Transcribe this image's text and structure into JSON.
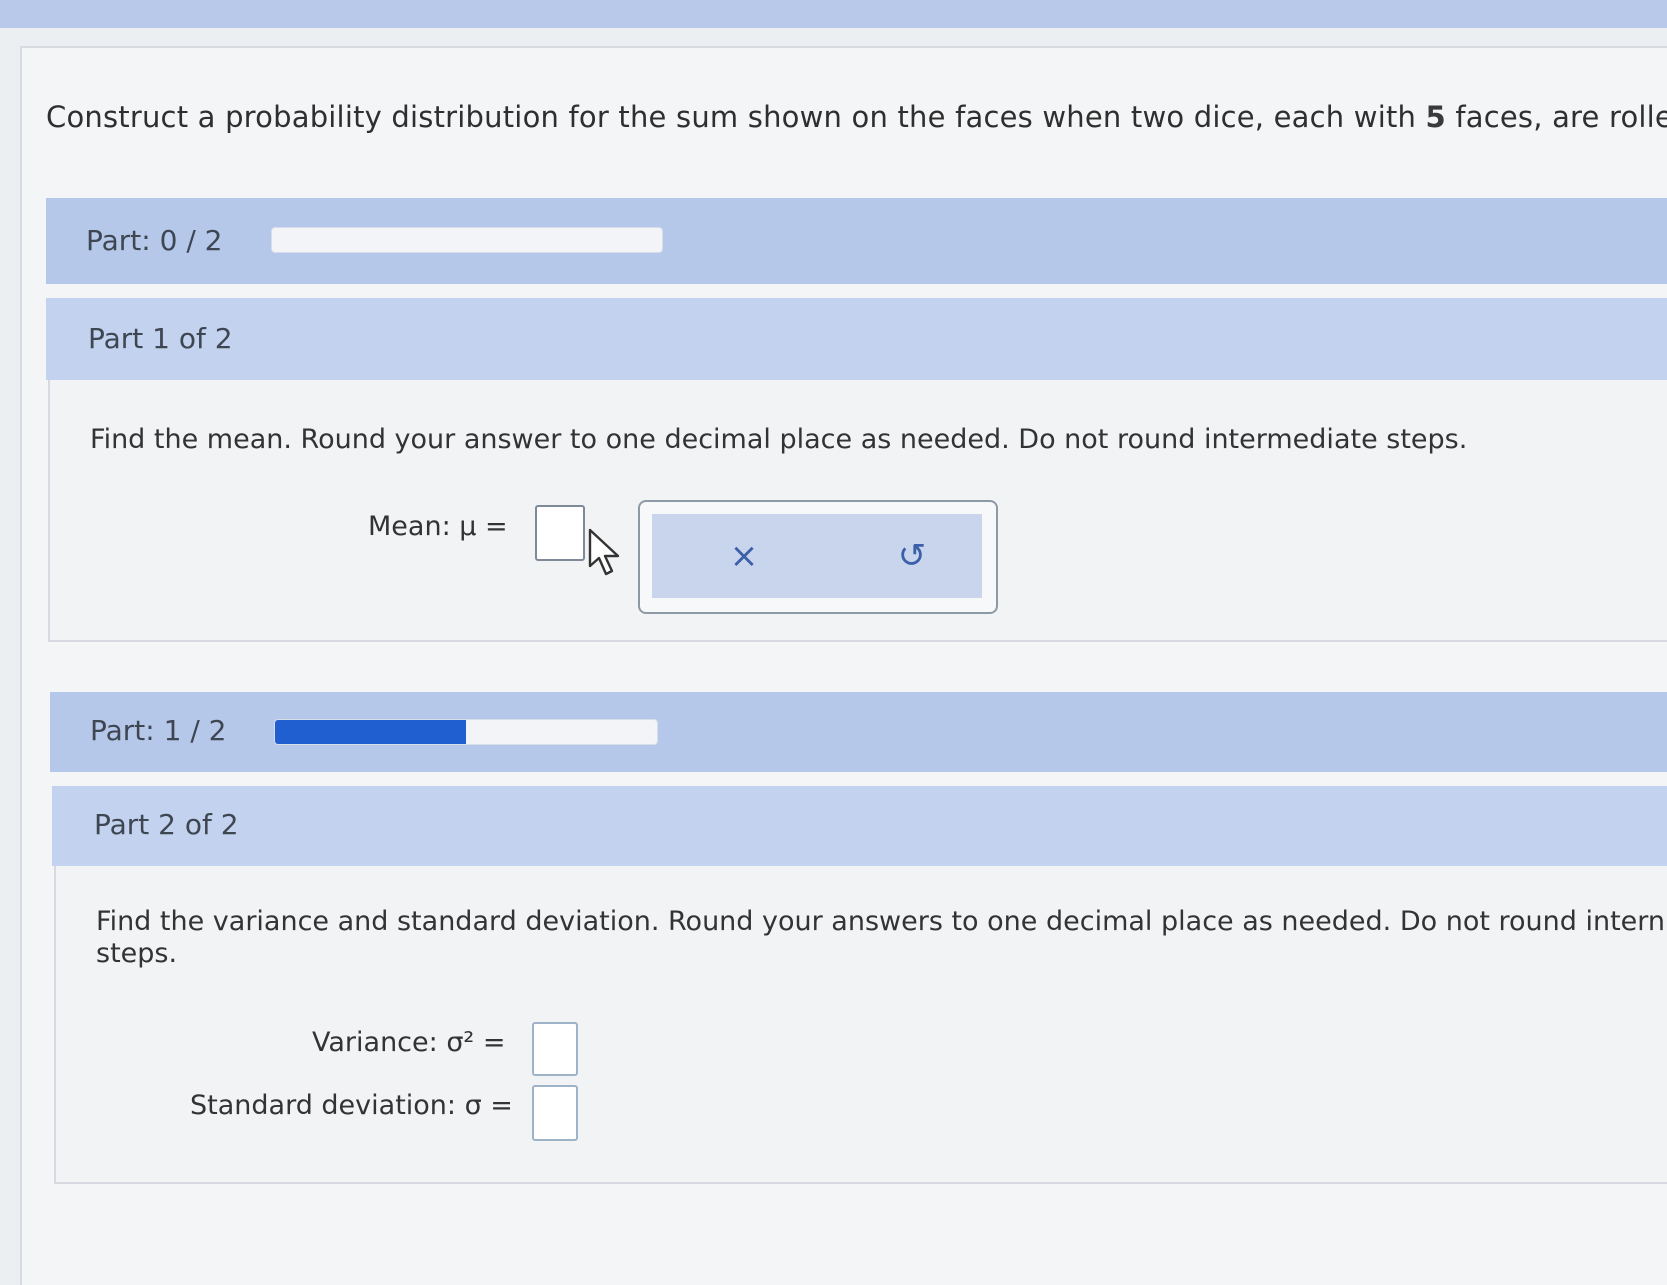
{
  "problem": {
    "text_before": "Construct a probability distribution for the sum shown on the faces when two dice, each with ",
    "faces": "5",
    "text_after": " faces, are rolled."
  },
  "progress_part1": {
    "label": "Part: 0 / 2",
    "fraction": 0.0
  },
  "part1": {
    "header": "Part 1 of 2",
    "prompt": "Find the mean. Round your answer to one decimal place as needed. Do not round intermediate steps.",
    "mean_label": "Mean: μ =",
    "mean_value": ""
  },
  "tools": {
    "clear_icon": "close-icon",
    "clear_glyph": "×",
    "undo_icon": "undo-icon",
    "undo_glyph": "↺"
  },
  "progress_part2": {
    "label": "Part: 1 / 2",
    "fraction": 0.5
  },
  "part2": {
    "header": "Part 2 of 2",
    "prompt_line1": "Find the variance and standard deviation. Round your answers to one decimal place as needed. Do not round intern",
    "prompt_line2": "steps.",
    "variance_label": "Variance: σ² =",
    "variance_value": "",
    "sd_label": "Standard deviation: σ =",
    "sd_value": ""
  },
  "colors": {
    "progress_fill": "#1f5fd0",
    "header_blue": "#b6c8ea"
  }
}
